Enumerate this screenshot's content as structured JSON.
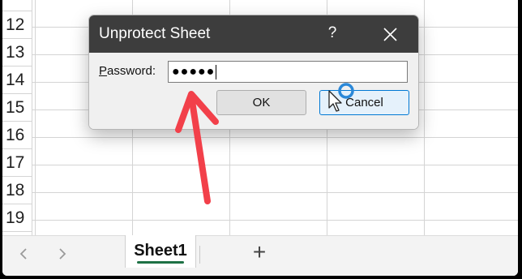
{
  "spreadsheet": {
    "row_numbers": [
      "",
      "12",
      "13",
      "14",
      "15",
      "16",
      "17",
      "18",
      "19"
    ]
  },
  "tabbar": {
    "prev_icon": "chevron-left-icon",
    "next_icon": "chevron-right-icon",
    "sheet_tab_label": "Sheet1",
    "add_sheet_label": "+",
    "active_underline_color": "#1e7145"
  },
  "dialog": {
    "title": "Unprotect Sheet",
    "help_label": "?",
    "close_icon": "close-icon",
    "password_label_mnemonic": "P",
    "password_label_rest": "assword:",
    "password_value": "●●●●●",
    "ok_label": "OK",
    "cancel_label": "Cancel",
    "titlebar_color": "#3d3d3d"
  },
  "annotation": {
    "arrow_color": "#f2404a",
    "cursor_highlight_color": "#2b88d8"
  }
}
